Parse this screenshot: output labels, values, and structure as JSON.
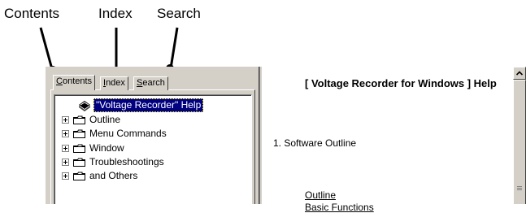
{
  "callouts": {
    "contents": "Contents",
    "index": "Index",
    "search": "Search"
  },
  "tabs": [
    {
      "label": "Contents",
      "mnemonic": "C",
      "rest": "ontents",
      "active": true
    },
    {
      "label": "Index",
      "mnemonic": "I",
      "rest": "ndex",
      "active": false
    },
    {
      "label": "Search",
      "mnemonic": "S",
      "rest": "earch",
      "active": false
    }
  ],
  "tree": {
    "root": {
      "label": "\"Voltage Recorder\" Help",
      "icon": "book-icon",
      "selected": true
    },
    "items": [
      {
        "label": "Outline",
        "icon": "folder-icon"
      },
      {
        "label": "Menu Commands",
        "icon": "folder-icon"
      },
      {
        "label": "Window",
        "icon": "folder-icon"
      },
      {
        "label": "Troubleshootings",
        "icon": "folder-icon"
      },
      {
        "label": "and Others",
        "icon": "folder-icon"
      }
    ]
  },
  "content": {
    "title": "[ Voltage Recorder for Windows ] Help",
    "section": "1. Software Outline",
    "links": [
      "Outline",
      "Basic Functions"
    ]
  },
  "scrollbar": {
    "up_icon": "arrow-up-icon"
  },
  "colors": {
    "window_face": "#d4d0c8",
    "selection": "#000080",
    "folder": "#ffffff"
  }
}
